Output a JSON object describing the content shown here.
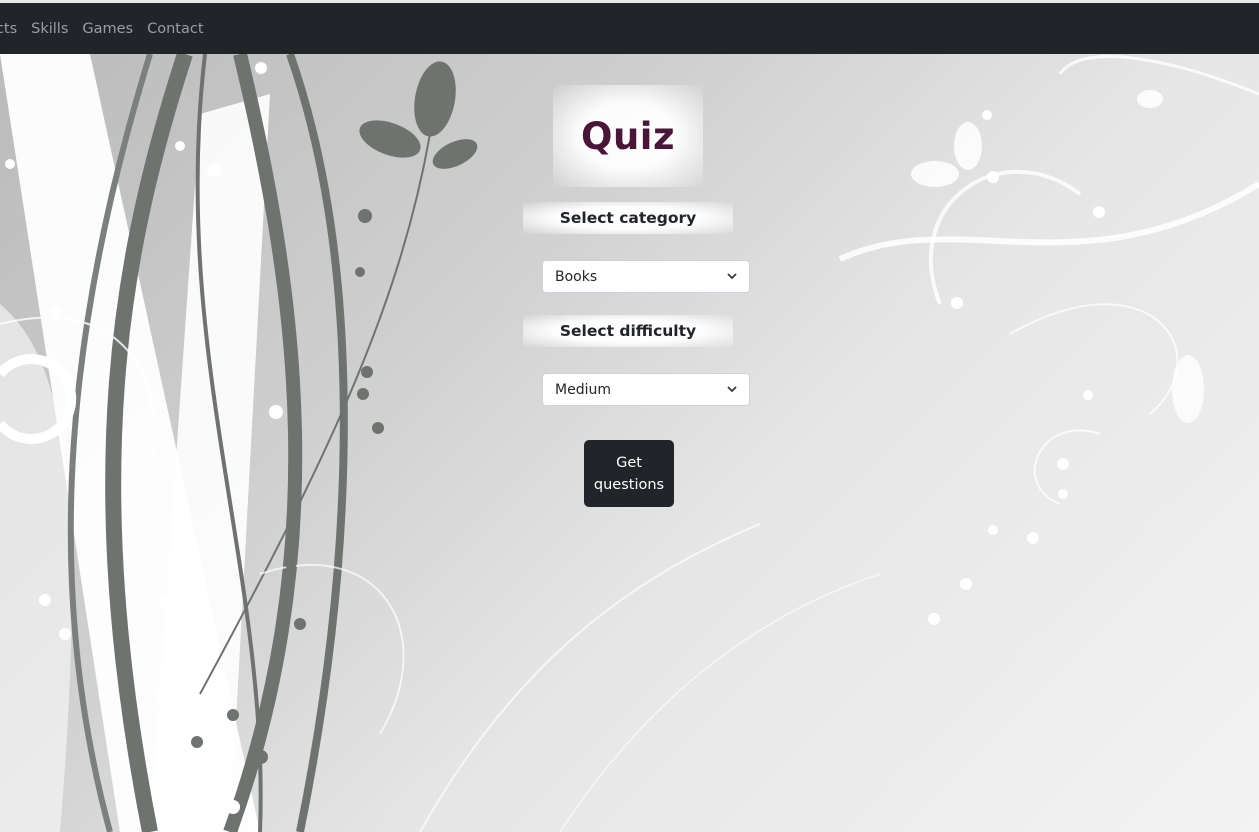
{
  "nav": {
    "items": [
      "ects",
      "Skills",
      "Games",
      "Contact"
    ]
  },
  "quiz": {
    "title": "Quiz",
    "category_label": "Select category",
    "category_value": "Books",
    "difficulty_label": "Select difficulty",
    "difficulty_value": "Medium",
    "button_label": "Get questions"
  },
  "colors": {
    "navbar": "#212529",
    "title": "#4a1538",
    "button": "#212529"
  },
  "icons": {
    "select_arrow": "chevron-down-icon"
  }
}
